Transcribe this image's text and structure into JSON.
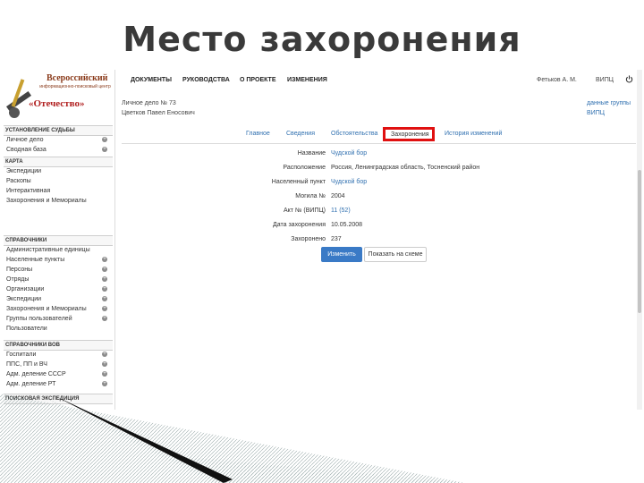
{
  "slide_title": "Место захоронения",
  "logo": {
    "line1": "Всероссийский",
    "line2": "информационно-поисковый центр",
    "line3": "«Отечество»"
  },
  "topnav": {
    "items": [
      "ДОКУМЕНТЫ",
      "РУКОВОДСТВА",
      "О ПРОЕКТЕ",
      "ИЗМЕНЕНИЯ"
    ],
    "user": "Фетьков А. М.",
    "org": "ВИПЦ"
  },
  "case": {
    "line1": "Личное дело № 73",
    "line2": "Цветков Павел Еносович"
  },
  "side_links": {
    "line1": "данные группы",
    "line2": "ВИПЦ"
  },
  "tabs": [
    "Главное",
    "Сведения",
    "Обстоятельства",
    "Захоронения",
    "История изменений"
  ],
  "active_tab": "Захоронения",
  "sidebar": {
    "sections": [
      {
        "title": "УСТАНОВЛЕНИЕ СУДЬБЫ",
        "items": [
          {
            "label": "Личное дело",
            "plus": true
          },
          {
            "label": "Сводная база",
            "plus": true
          }
        ]
      },
      {
        "title": "КАРТА",
        "items": [
          {
            "label": "Экспедиции",
            "plus": false
          },
          {
            "label": "Раскопы",
            "plus": false
          },
          {
            "label": "Интерактивная",
            "plus": false
          },
          {
            "label": "Захоронения и Мемориалы",
            "plus": false
          }
        ]
      },
      {
        "title": "СПРАВОЧНИКИ",
        "items": [
          {
            "label": "Административные единицы",
            "plus": false
          },
          {
            "label": "Населенные пункты",
            "plus": true
          },
          {
            "label": "Персоны",
            "plus": true
          },
          {
            "label": "Отряды",
            "plus": true
          },
          {
            "label": "Организации",
            "plus": true
          },
          {
            "label": "Экспедиции",
            "plus": true
          },
          {
            "label": "Захоронения и Мемориалы",
            "plus": true
          },
          {
            "label": "Группы пользователей",
            "plus": true
          },
          {
            "label": "Пользователи",
            "plus": false
          }
        ]
      },
      {
        "title": "СПРАВОЧНИКИ ВОВ",
        "items": [
          {
            "label": "Госпитали",
            "plus": true
          },
          {
            "label": "ППС, ПП и ВЧ",
            "plus": true
          },
          {
            "label": "Адм. деление СССР",
            "plus": true
          },
          {
            "label": "Адм. деление РТ",
            "plus": true
          }
        ]
      },
      {
        "title": "ПОИСКОВАЯ ЭКСПЕДИЦИЯ",
        "items": []
      }
    ]
  },
  "form": [
    {
      "label": "Название",
      "value": "Чудской бор",
      "link": true
    },
    {
      "label": "Расположение",
      "value": "Россия, Ленинградская область, Тосненский район",
      "link": false
    },
    {
      "label": "Населенный пункт",
      "value": "Чудской бор",
      "link": true
    },
    {
      "label": "Могила №",
      "value": "2004",
      "link": false
    },
    {
      "label": "Акт № (ВИПЦ)",
      "value": "11 (52)",
      "link": true
    },
    {
      "label": "Дата захоронения",
      "value": "10.05.2008",
      "link": false
    },
    {
      "label": "Захоронено",
      "value": "237",
      "link": false
    }
  ],
  "buttons": {
    "edit": "Изменить",
    "show_map": "Показать на схеме"
  }
}
